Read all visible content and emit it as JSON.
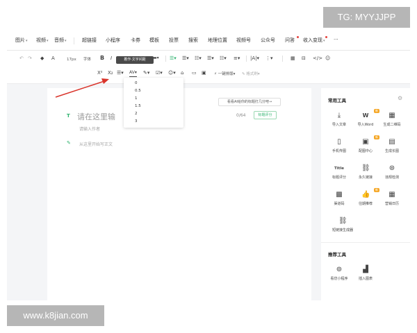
{
  "watermarks": {
    "top": "TG: MYYJJPP",
    "bottom": "www.k8jian.com"
  },
  "menu": {
    "items": [
      "图片",
      "视频",
      "音频",
      "超链接",
      "小程序",
      "卡券",
      "模板",
      "投票",
      "搜索",
      "地理位置",
      "视频号",
      "公众号",
      "问答",
      "收入变现",
      "···"
    ]
  },
  "toolbar": {
    "undo": "↶",
    "redo": "↷",
    "format_brush": "◆",
    "clear": "A",
    "font_size": "17px",
    "font_family": "字体",
    "bold": "B",
    "italic": "I",
    "underline": "U",
    "strike": "S",
    "superscript": "X²",
    "subscript": "X₂",
    "letter_spacing": "AV",
    "one_key_layout": "一键排版",
    "typeset": "格式刷",
    "code": "</>"
  },
  "tooltip": "着作·文字间距",
  "letter_spacing_options": [
    "0",
    "0.5",
    "1",
    "1.5",
    "2",
    "3"
  ],
  "editor": {
    "title_placeholder": "请在这里输",
    "title_count": "0/64",
    "title_score_button": "标题评分",
    "ai_tip": "看看AI给你的标题打几分吧→",
    "author_placeholder": "请输入作者",
    "body_placeholder": "从这里开始写正文"
  },
  "panel": {
    "common_title": "常用工具",
    "tools": [
      {
        "label": "导入文章",
        "icon": "import-article-icon",
        "glyph": "⤓"
      },
      {
        "label": "导入Word",
        "icon": "word-icon",
        "glyph": "W"
      },
      {
        "label": "生成二维码",
        "icon": "qrcode-icon",
        "glyph": "▦"
      },
      {
        "label": "手机传图",
        "icon": "phone-upload-icon",
        "glyph": "▯"
      },
      {
        "label": "配图中心",
        "icon": "image-center-icon",
        "glyph": "▣"
      },
      {
        "label": "生成长图",
        "icon": "long-image-icon",
        "glyph": "▤"
      },
      {
        "label": "标题评分",
        "icon": "title-score-icon",
        "glyph": "Title"
      },
      {
        "label": "永久链接",
        "icon": "link-icon",
        "glyph": "⛓"
      },
      {
        "label": "违规检测",
        "icon": "check-icon",
        "glyph": "⊛"
      },
      {
        "label": "渠道码",
        "icon": "channel-code-icon",
        "glyph": "▩"
      },
      {
        "label": "往期推荐",
        "icon": "thumb-icon",
        "glyph": "👍"
      },
      {
        "label": "营销日历",
        "icon": "calendar-icon",
        "glyph": "▦"
      },
      {
        "label": "短链接生成器",
        "icon": "short-link-icon",
        "glyph": "⛓"
      }
    ],
    "recommend_title": "推荐工具",
    "recommend_tools": [
      {
        "label": "看仿小程序",
        "icon": "mini-program-icon",
        "glyph": "⊚"
      },
      {
        "label": "插入图表",
        "icon": "chart-icon",
        "glyph": "▟"
      }
    ],
    "badge_new": "新"
  }
}
